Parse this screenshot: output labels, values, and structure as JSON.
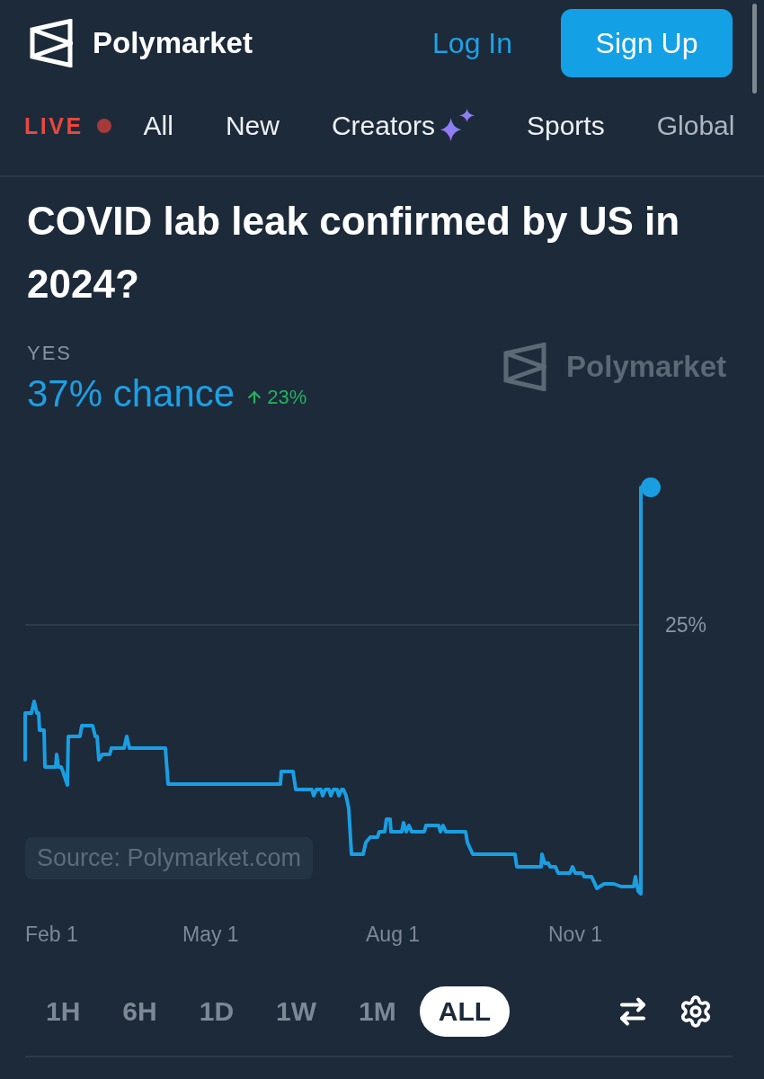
{
  "header": {
    "brand": "Polymarket",
    "login": "Log In",
    "signup": "Sign Up"
  },
  "nav": {
    "live": "LIVE",
    "items": [
      {
        "label": "All",
        "kind": "text"
      },
      {
        "label": "New",
        "kind": "text"
      },
      {
        "label": "Creators",
        "kind": "sparkle"
      },
      {
        "label": "Sports",
        "kind": "text"
      },
      {
        "label": "Global",
        "kind": "faded"
      }
    ]
  },
  "market": {
    "title": "COVID lab leak confirmed by US in 2024?",
    "outcome": "YES",
    "chance": "37% chance",
    "change": {
      "up": true,
      "value": "23%"
    }
  },
  "chart": {
    "watermark": "Polymarket",
    "y_tick": "25%",
    "x_labels": [
      "Feb 1",
      "May 1",
      "Aug 1",
      "Nov 1"
    ],
    "source": "Source: Polymarket.com"
  },
  "ranges": [
    {
      "label": "1H",
      "selected": false
    },
    {
      "label": "6H",
      "selected": false
    },
    {
      "label": "1D",
      "selected": false
    },
    {
      "label": "1W",
      "selected": false
    },
    {
      "label": "1M",
      "selected": false
    },
    {
      "label": "ALL",
      "selected": true
    }
  ],
  "tools": [
    {
      "kind": "swap"
    },
    {
      "kind": "settings"
    }
  ]
}
